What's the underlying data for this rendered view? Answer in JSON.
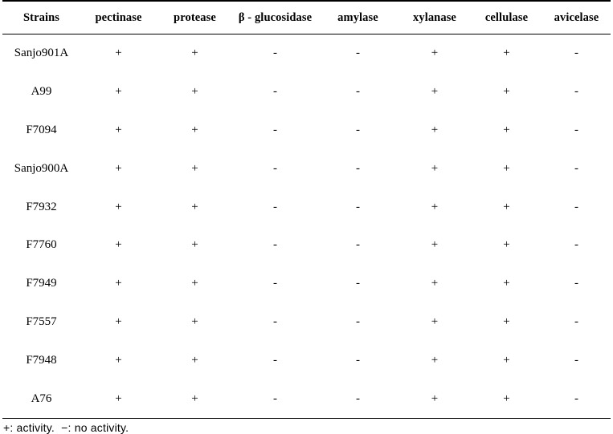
{
  "table": {
    "columns": [
      "Strains",
      "pectinase",
      "protease",
      "β - glucosidase",
      "amylase",
      "xylanase",
      "cellulase",
      "avicelase"
    ],
    "rows": [
      {
        "strain": "Sanjo901A",
        "values": [
          "+",
          "+",
          "-",
          "-",
          "+",
          "+",
          "-"
        ]
      },
      {
        "strain": "A99",
        "values": [
          "+",
          "+",
          "-",
          "-",
          "+",
          "+",
          "-"
        ]
      },
      {
        "strain": "F7094",
        "values": [
          "+",
          "+",
          "-",
          "-",
          "+",
          "+",
          "-"
        ]
      },
      {
        "strain": "Sanjo900A",
        "values": [
          "+",
          "+",
          "-",
          "-",
          "+",
          "+",
          "-"
        ]
      },
      {
        "strain": "F7932",
        "values": [
          "+",
          "+",
          "-",
          "-",
          "+",
          "+",
          "-"
        ]
      },
      {
        "strain": "F7760",
        "values": [
          "+",
          "+",
          "-",
          "-",
          "+",
          "+",
          "-"
        ]
      },
      {
        "strain": "F7949",
        "values": [
          "+",
          "+",
          "-",
          "-",
          "+",
          "+",
          "-"
        ]
      },
      {
        "strain": "F7557",
        "values": [
          "+",
          "+",
          "-",
          "-",
          "+",
          "+",
          "-"
        ]
      },
      {
        "strain": "F7948",
        "values": [
          "+",
          "+",
          "-",
          "-",
          "+",
          "+",
          "-"
        ]
      },
      {
        "strain": "A76",
        "values": [
          "+",
          "+",
          "-",
          "-",
          "+",
          "+",
          "-"
        ]
      }
    ],
    "footnote": "+: activity.  −: no activity."
  }
}
